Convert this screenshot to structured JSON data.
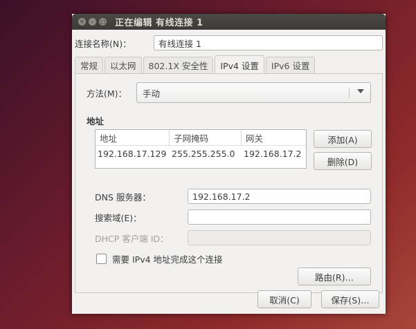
{
  "window": {
    "title": "正在编辑 有线连接 1"
  },
  "connection": {
    "label": "连接名称(N)：",
    "value": "有线连接 1"
  },
  "tabs": [
    {
      "label": "常规"
    },
    {
      "label": "以太网"
    },
    {
      "label": "802.1X 安全性"
    },
    {
      "label": "IPv4 设置",
      "active": true
    },
    {
      "label": "IPv6 设置"
    }
  ],
  "method": {
    "label": "方法(M)：",
    "value": "手动"
  },
  "addresses": {
    "title": "地址",
    "columns": [
      "地址",
      "子网掩码",
      "网关"
    ],
    "rows": [
      [
        "192.168.17.129",
        "255.255.255.0",
        "192.168.17.2"
      ]
    ],
    "add_label": "添加(A)",
    "delete_label": "删除(D)"
  },
  "fields": {
    "dns_label": "DNS 服务器：",
    "dns_value": "192.168.17.2",
    "search_label": "搜索域(E)：",
    "search_value": "",
    "dhcp_label": "DHCP 客户端 ID：",
    "dhcp_value": ""
  },
  "require_ipv4": {
    "label": "需要 IPv4 地址完成这个连接",
    "checked": false
  },
  "route_label": "路由(R)…",
  "footer": {
    "cancel_label": "取消(C)",
    "save_label": "保存(S)…"
  }
}
